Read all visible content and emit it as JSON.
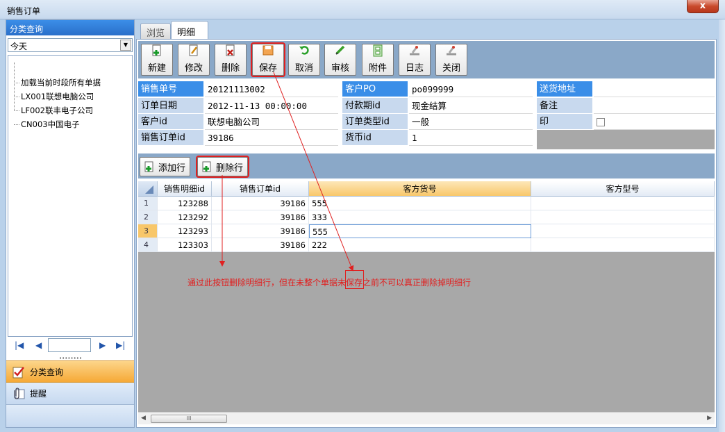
{
  "window": {
    "title": "销售订单",
    "close_label": "x"
  },
  "left": {
    "header": "分类查询",
    "filter_value": "今天",
    "tree": [
      "加载当前时段所有单据",
      "LX001联想电脑公司",
      "LF002联丰电子公司",
      "CN003中国电子"
    ],
    "pager": {
      "first": "|◀",
      "prev": "◀",
      "next": "▶",
      "last": "▶|",
      "value": ""
    },
    "grip": "••••••••",
    "nav": [
      {
        "label": "分类查询",
        "icon": "checklist-icon"
      },
      {
        "label": "提醒",
        "icon": "clip-icon"
      }
    ]
  },
  "tabs": [
    "浏览",
    "明细"
  ],
  "toolbar": [
    {
      "label": "新建",
      "icon": "new-doc-icon"
    },
    {
      "label": "修改",
      "icon": "edit-icon"
    },
    {
      "label": "删除",
      "icon": "delete-icon"
    },
    {
      "label": "保存",
      "icon": "save-icon"
    },
    {
      "label": "取消",
      "icon": "undo-icon"
    },
    {
      "label": "审核",
      "icon": "pencil-icon"
    },
    {
      "label": "附件",
      "icon": "attachment-icon"
    },
    {
      "label": "日志",
      "icon": "log-icon"
    },
    {
      "label": "关闭",
      "icon": "close-doc-icon"
    }
  ],
  "form": {
    "col1": [
      {
        "label": "销售单号",
        "value": "20121113002"
      },
      {
        "label": "订单日期",
        "value": "2012-11-13 00:00:00"
      },
      {
        "label": "客户id",
        "value": "联想电脑公司"
      },
      {
        "label": "销售订单id",
        "value": "39186"
      }
    ],
    "col2": [
      {
        "label": "客户PO",
        "value": "po099999"
      },
      {
        "label": "付款期id",
        "value": "现金结算"
      },
      {
        "label": "订单类型id",
        "value": "一般"
      },
      {
        "label": "货币id",
        "value": "1"
      }
    ],
    "col3": [
      {
        "label": "送货地址",
        "value": ""
      },
      {
        "label": "备注",
        "value": ""
      },
      {
        "label": "印",
        "value": ""
      }
    ]
  },
  "row_toolbar": {
    "add": "添加行",
    "delete": "删除行"
  },
  "grid": {
    "columns": [
      "销售明细id",
      "销售订单id",
      "客方货号",
      "客方型号"
    ],
    "rows": [
      {
        "n": "1",
        "detail_id": "123288",
        "order_id": "39186",
        "part": "555",
        "model": ""
      },
      {
        "n": "2",
        "detail_id": "123292",
        "order_id": "39186",
        "part": "333",
        "model": ""
      },
      {
        "n": "3",
        "detail_id": "123293",
        "order_id": "39186",
        "part": "555",
        "model": ""
      },
      {
        "n": "4",
        "detail_id": "123303",
        "order_id": "39186",
        "part": "222",
        "model": ""
      }
    ],
    "scroll_thumb": "III"
  },
  "annotation": "通过此按钮删除明细行，但在未整个单据未保存之前不可以真正删除掉明细行",
  "colors": {
    "accent_red": "#e02020",
    "header_blue": "#3a8ee8",
    "toolbar_bg": "#8aa8c8",
    "active_nav": "#f6a936"
  }
}
